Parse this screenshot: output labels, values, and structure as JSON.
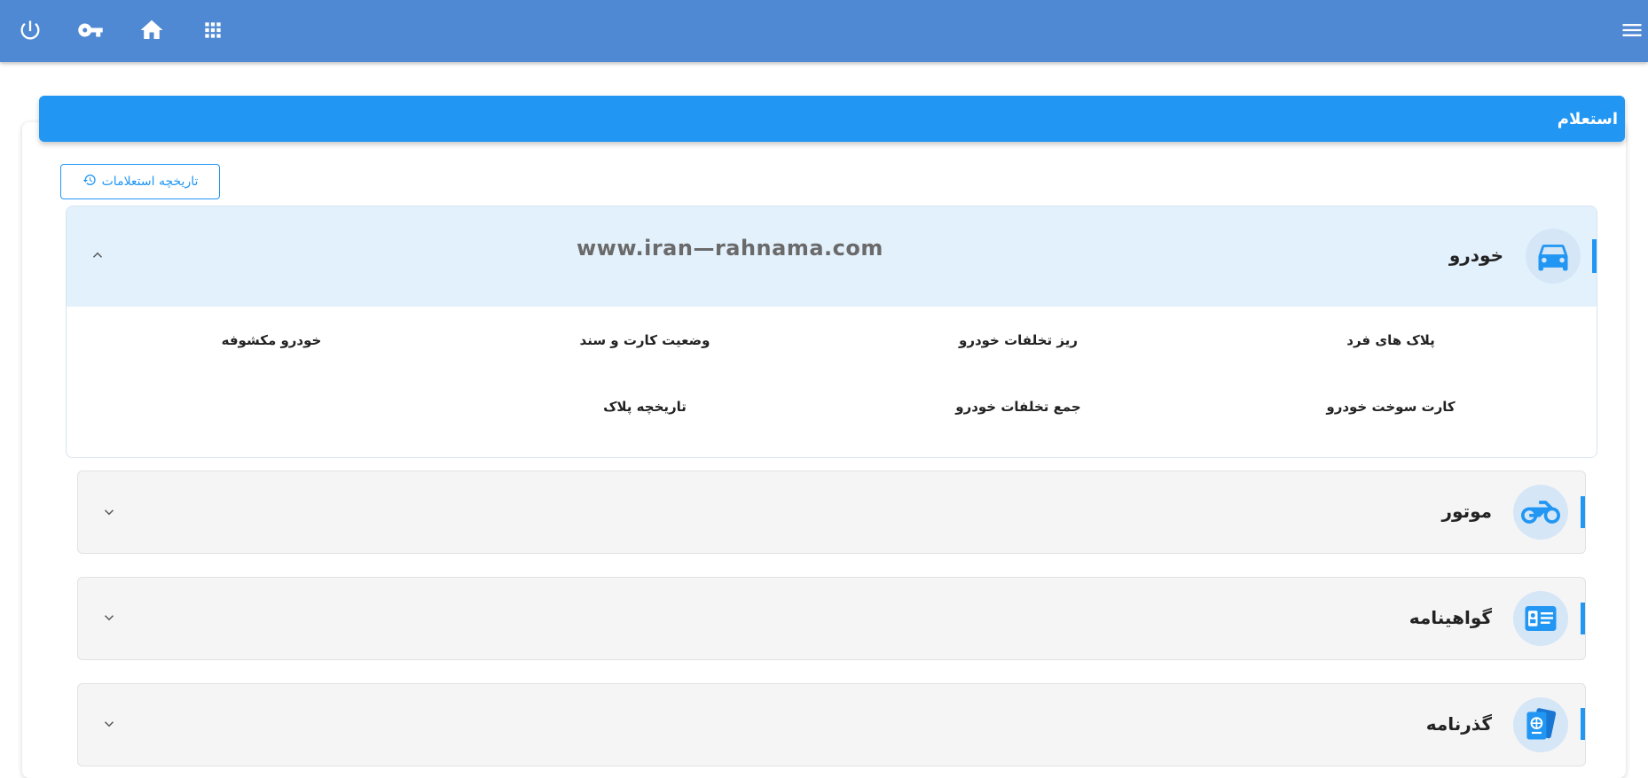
{
  "topbar": {
    "icons": [
      "power-icon",
      "key-icon",
      "home-icon",
      "apps-grid-icon",
      "menu-icon"
    ]
  },
  "card": {
    "title": "استعلام",
    "history_button_label": "تاریخچه استعلامات"
  },
  "watermark": "www.iran—rahnama.com",
  "sections": [
    {
      "title": "خودرو",
      "icon": "car-icon",
      "expanded": true,
      "items": [
        "پلاک های فرد",
        "ریز تخلفات خودرو",
        "وضعیت کارت و سند",
        "خودرو مکشوفه",
        "کارت سوخت خودرو",
        "جمع تخلفات خودرو",
        "تاریخچه پلاک"
      ]
    },
    {
      "title": "موتور",
      "icon": "motorcycle-icon",
      "expanded": false
    },
    {
      "title": "گواهینامه",
      "icon": "license-card-icon",
      "expanded": false
    },
    {
      "title": "گذرنامه",
      "icon": "passport-icon",
      "expanded": false
    }
  ],
  "colors": {
    "topbar": "#4f88d3",
    "accent": "#2196f3",
    "panel_header_bg": "#e3f1fc",
    "collapsed_bg": "#f5f5f5"
  }
}
